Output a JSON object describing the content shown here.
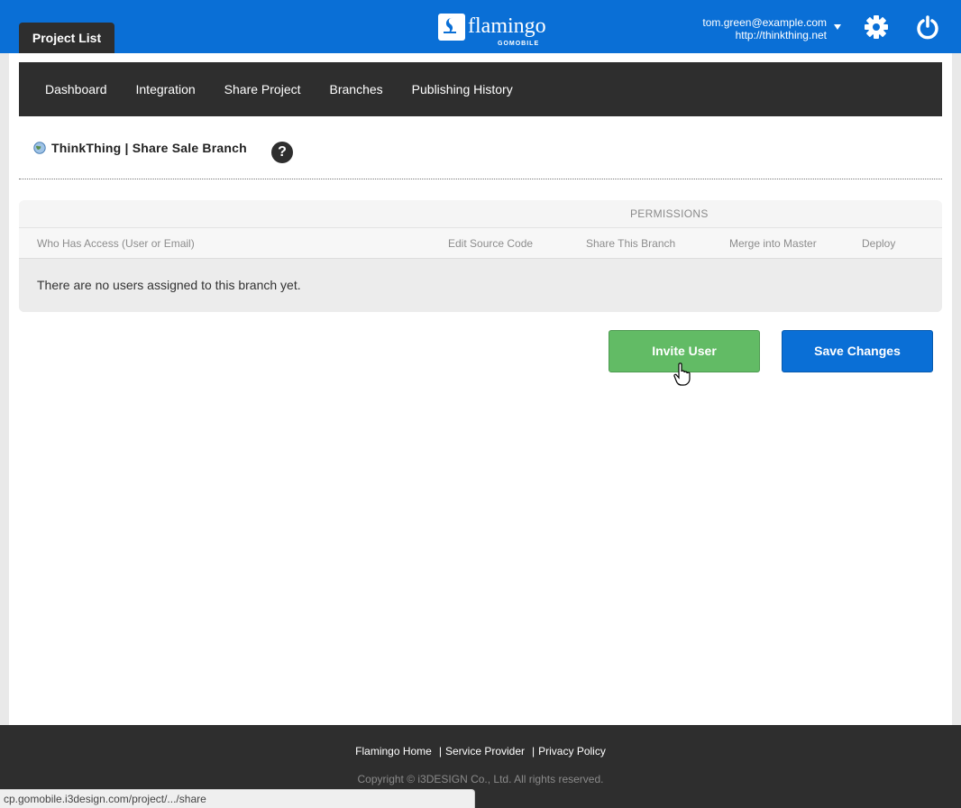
{
  "header": {
    "project_tab": "Project List",
    "logo_text": "flamingo",
    "logo_sub": "GOMOBILE",
    "account_email": "tom.green@example.com",
    "account_site": "http://thinkthing.net"
  },
  "subnav": {
    "items": [
      {
        "label": "Dashboard"
      },
      {
        "label": "Integration"
      },
      {
        "label": "Share Project"
      },
      {
        "label": "Branches"
      },
      {
        "label": "Publishing History"
      }
    ]
  },
  "page": {
    "title": "ThinkThing | Share Sale Branch",
    "help": "?"
  },
  "table": {
    "permissions_title": "PERMISSIONS",
    "columns": [
      "Who Has Access (User or Email)",
      "Edit Source Code",
      "Share This Branch",
      "Merge into Master",
      "Deploy"
    ],
    "empty_message": "There are no users assigned to this branch yet."
  },
  "actions": {
    "invite_label": "Invite User",
    "save_label": "Save Changes"
  },
  "footer": {
    "links": [
      "Flamingo Home",
      "Service Provider",
      "Privacy Policy"
    ],
    "copyright": "Copyright © i3DESIGN Co., Ltd. All rights reserved."
  },
  "status_url": "cp.gomobile.i3design.com/project/.../share",
  "colors": {
    "brand_blue": "#0a6fd6",
    "dark": "#2e2e2e",
    "invite_green": "#62bb65"
  }
}
